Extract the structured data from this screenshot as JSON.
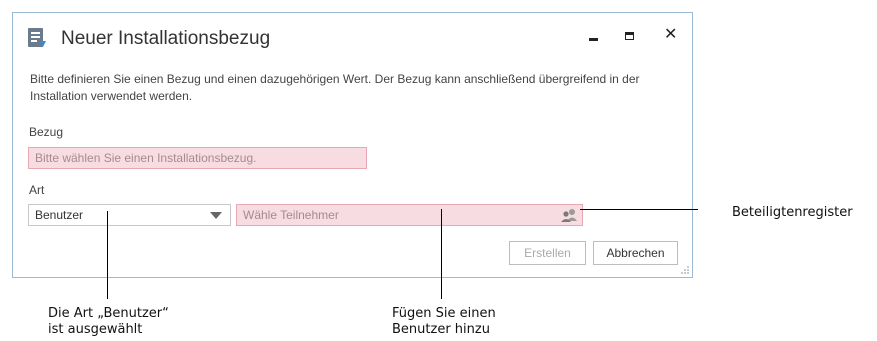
{
  "dialog": {
    "title": "Neuer Installationsbezug",
    "description": "Bitte definieren Sie einen Bezug und einen dazugehörigen Wert. Der Bezug kann anschließend übergreifend in der Installation verwendet werden.",
    "window_controls": {
      "minimize_icon": "minimize-icon",
      "maximize_icon": "maximize-icon",
      "close_symbol": "✕"
    },
    "bezug": {
      "label": "Bezug",
      "placeholder": "Bitte wählen Sie einen Installationsbezug."
    },
    "art": {
      "label": "Art",
      "selected": "Benutzer"
    },
    "participant": {
      "placeholder": "Wähle Teilnehmer"
    },
    "buttons": {
      "create": "Erstellen",
      "cancel": "Abbrechen"
    },
    "colors": {
      "border": "#9bbad6",
      "required_bg": "#f7dde2",
      "required_border": "#e6a9b4"
    }
  },
  "callouts": {
    "register": "Beteiligtenregister",
    "art_line1": "Die Art „Benutzer“",
    "art_line2": "ist ausgewählt",
    "user_line1": "Fügen Sie einen",
    "user_line2": "Benutzer hinzu"
  }
}
